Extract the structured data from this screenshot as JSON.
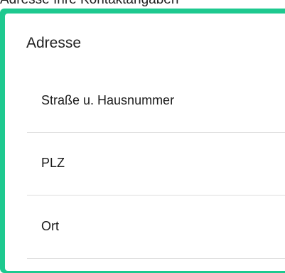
{
  "header_partial": {
    "text": "Adresse    Ihre Kontaktangaben"
  },
  "card": {
    "title": "Adresse",
    "fields": [
      {
        "label": "Straße u. Hausnummer"
      },
      {
        "label": "PLZ"
      },
      {
        "label": "Ort"
      }
    ]
  },
  "colors": {
    "accent": "#1ec98f",
    "divider": "#dedede",
    "text": "#1a1a1a"
  }
}
